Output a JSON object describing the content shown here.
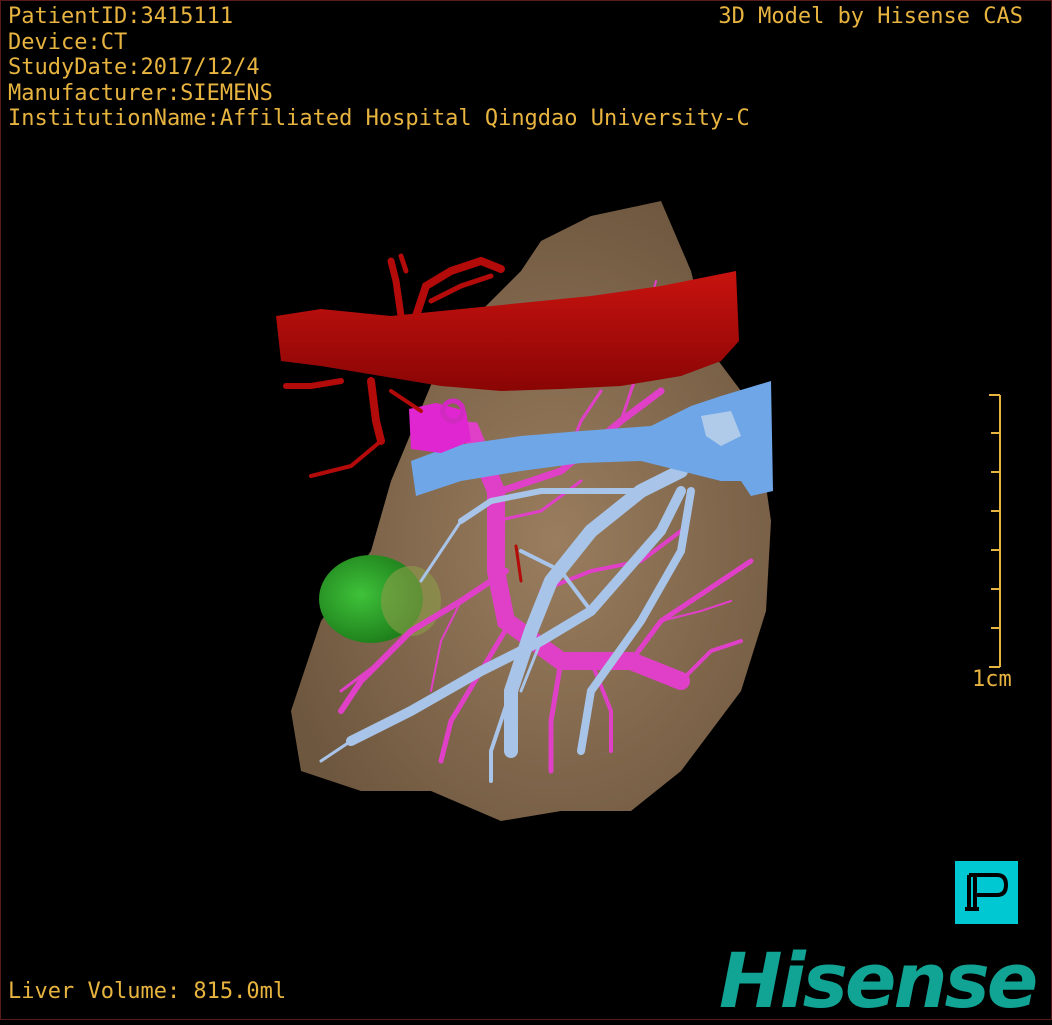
{
  "header": {
    "patient_id": "PatientID:3415111",
    "device": "Device:CT",
    "study_date": "StudyDate:2017/12/4",
    "manufacturer": "Manufacturer:SIEMENS",
    "institution": "InstitutionName:Affiliated Hospital Qingdao University-C",
    "model_credit": "3D Model by Hisense CAS"
  },
  "scale_bar": {
    "label": "1cm"
  },
  "footer": {
    "liver_volume": "Liver Volume:  815.0ml"
  },
  "orientation_marker": {
    "letter": "P",
    "icon": "posterior-orientation-cube-icon"
  },
  "logo": {
    "text": "Hisense"
  },
  "colors": {
    "overlay_text": "#e8b440",
    "liver": "#8c7154",
    "artery": "#b30a0a",
    "hepatic_vein": "#6fa6e8",
    "portal_vein": "#e040c8",
    "tumor": "#2fae2a",
    "orientation_cube": "#00c8d2",
    "logo": "#11a394"
  }
}
